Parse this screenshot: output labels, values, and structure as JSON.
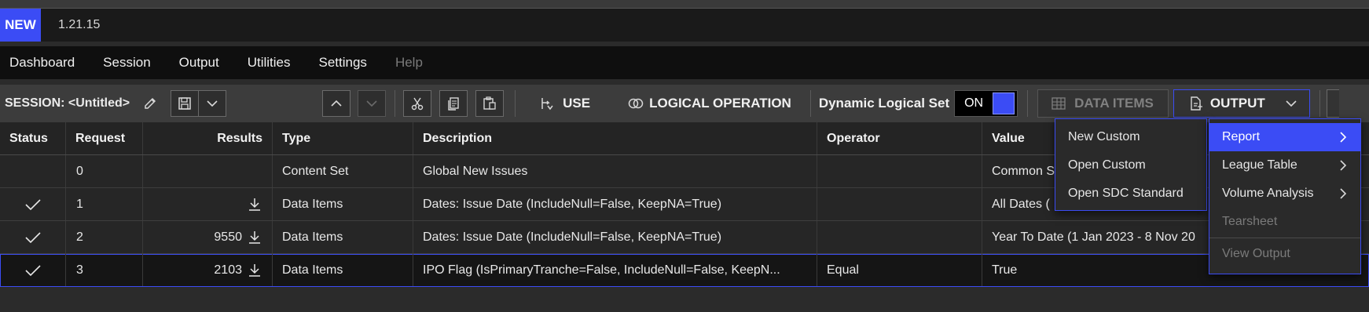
{
  "app": {
    "badge": "NEW",
    "version": "1.21.15"
  },
  "menu": [
    "Dashboard",
    "Session",
    "Output",
    "Utilities",
    "Settings",
    "Help"
  ],
  "toolbar": {
    "session_label": "SESSION: <Untitled>",
    "use_label": "USE",
    "logical_label": "LOGICAL OPERATION",
    "dynamic_label": "Dynamic Logical Set",
    "toggle_value": "ON",
    "data_items_label": "DATA ITEMS",
    "output_label": "OUTPUT"
  },
  "table": {
    "headers": [
      "Status",
      "Request",
      "Results",
      "Type",
      "Description",
      "Operator",
      "Value"
    ],
    "rows": [
      {
        "status": "",
        "request": "0",
        "results": "",
        "type": "Content Set",
        "description": "Global New Issues",
        "operator": "",
        "value": "Common S"
      },
      {
        "status": "check",
        "request": "1",
        "results": "",
        "type": "Data Items",
        "description": "Dates: Issue Date (IncludeNull=False, KeepNA=True)",
        "operator": "",
        "value": "All Dates ("
      },
      {
        "status": "check",
        "request": "2",
        "results": "9550",
        "type": "Data Items",
        "description": "Dates: Issue Date (IncludeNull=False, KeepNA=True)",
        "operator": "",
        "value": "Year To Date (1 Jan 2023 - 8 Nov 20"
      },
      {
        "status": "check",
        "request": "3",
        "results": "2103",
        "type": "Data Items",
        "description": "IPO Flag (IsPrimaryTranche=False, IncludeNull=False, KeepN...",
        "operator": "Equal",
        "value": "True"
      }
    ]
  },
  "report_menu": [
    "New Custom",
    "Open Custom",
    "Open SDC Standard"
  ],
  "output_menu": {
    "items": [
      {
        "label": "Report",
        "submenu": true,
        "state": "active"
      },
      {
        "label": "League Table",
        "submenu": true,
        "state": "normal"
      },
      {
        "label": "Volume Analysis",
        "submenu": true,
        "state": "normal"
      },
      {
        "label": "Tearsheet",
        "submenu": false,
        "state": "disabled"
      },
      {
        "label": "View Output",
        "submenu": false,
        "state": "disabled"
      }
    ]
  },
  "colors": {
    "accent": "#3b4cf5",
    "background": "#2b2b2b",
    "menubar": "#0f0f0f"
  }
}
